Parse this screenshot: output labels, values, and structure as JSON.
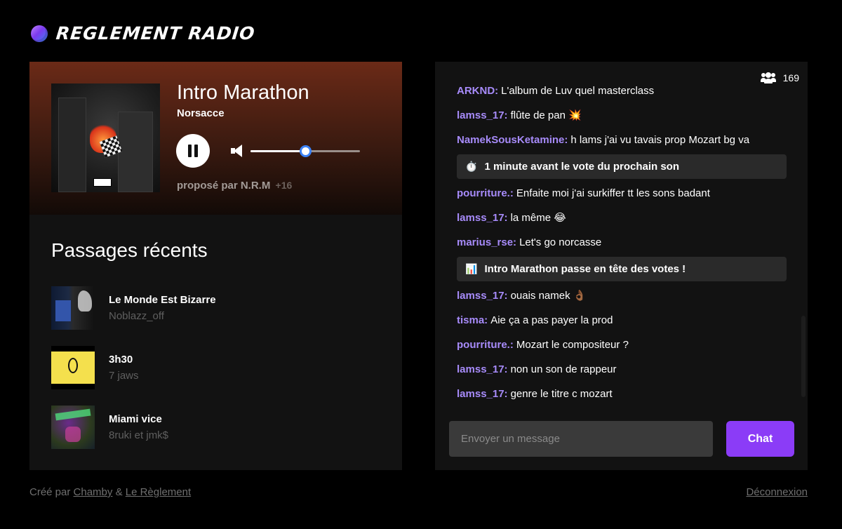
{
  "app": {
    "title": "REGLEMENT RADIO"
  },
  "player": {
    "title": "Intro Marathon",
    "artist": "Norsacce",
    "proposed_by": "proposé par N.R.M",
    "votes": "+16",
    "volume": 0.5,
    "state": "playing"
  },
  "recent": {
    "heading": "Passages récents",
    "items": [
      {
        "name": "Le Monde Est Bizarre",
        "artist": "Noblazz_off"
      },
      {
        "name": "3h30",
        "artist": "7 jaws"
      },
      {
        "name": "Miami vice",
        "artist": "8ruki et jmk$"
      }
    ]
  },
  "chat": {
    "listener_count": "169",
    "messages": [
      {
        "type": "user",
        "user": "ARKND:",
        "text": "L'album de Luv quel masterclass"
      },
      {
        "type": "user",
        "user": "lamss_17:",
        "text": "flûte de pan 💥"
      },
      {
        "type": "user",
        "user": "NamekSousKetamine:",
        "text": "h lams j'ai vu tavais prop Mozart bg va"
      },
      {
        "type": "system",
        "icon": "⏱️",
        "text": "1 minute avant le vote du prochain son"
      },
      {
        "type": "user",
        "user": "pourriture.:",
        "text": "Enfaite moi j'ai surkiffer tt les sons badant"
      },
      {
        "type": "user",
        "user": "lamss_17:",
        "text": "la même 😂"
      },
      {
        "type": "user",
        "user": "marius_rse:",
        "text": "Let's go norcasse"
      },
      {
        "type": "system",
        "icon": "📊",
        "text": "Intro Marathon passe en tête des votes !"
      },
      {
        "type": "user",
        "user": "lamss_17:",
        "text": "ouais namek 👌🏾"
      },
      {
        "type": "user",
        "user": "tisma:",
        "text": "Aie ça a pas payer la prod"
      },
      {
        "type": "user",
        "user": "pourriture.:",
        "text": "Mozart le compositeur ?"
      },
      {
        "type": "user",
        "user": "lamss_17:",
        "text": "non un son de rappeur"
      },
      {
        "type": "user",
        "user": "lamss_17:",
        "text": "genre le titre c mozart"
      }
    ],
    "input_placeholder": "Envoyer un message",
    "send_label": "Chat"
  },
  "footer": {
    "created_by": "Créé par",
    "author1": "Chamby",
    "amp": "&",
    "author2": "Le Règlement",
    "logout": "Déconnexion"
  },
  "colors": {
    "accent": "#8b3cf7",
    "username": "#a78bfa",
    "slider_knob_border": "#3b82f6"
  }
}
